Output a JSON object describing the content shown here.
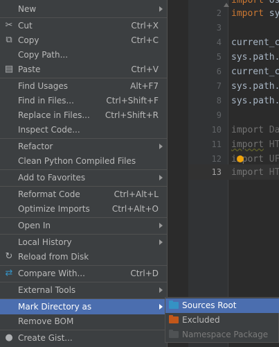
{
  "editor": {
    "line_numbers": [
      "2",
      "3",
      "4",
      "5",
      "6",
      "7",
      "8",
      "9",
      "10",
      "11",
      "12",
      "13"
    ],
    "current_line": "13",
    "lines": [
      {
        "kw": "import",
        "rest": " sy"
      },
      {
        "kw": "",
        "rest": ""
      },
      {
        "kw": "",
        "rest": "current_c"
      },
      {
        "kw": "",
        "rest": "sys.path."
      },
      {
        "kw": "",
        "rest": "current_c"
      },
      {
        "kw": "",
        "rest": "sys.path."
      },
      {
        "kw": "",
        "rest": "sys.path."
      },
      {
        "kw": "",
        "rest": ""
      },
      {
        "kw": "import",
        "rest": " Da"
      },
      {
        "kw": "import",
        "rest": " HT"
      },
      {
        "kw": "import",
        "rest": " UF"
      },
      {
        "kw": "import",
        "rest": " HT"
      }
    ],
    "top_partial": {
      "kw": "import",
      "rest": " os"
    }
  },
  "menu": {
    "items": [
      {
        "label": "New",
        "icon": "",
        "shortcut": "",
        "submenu": true
      },
      {
        "label": "Cut",
        "icon": "✂",
        "shortcut": "Ctrl+X",
        "submenu": false
      },
      {
        "label": "Copy",
        "icon": "⧉",
        "shortcut": "Ctrl+C",
        "submenu": false
      },
      {
        "label": "Copy Path...",
        "icon": "",
        "shortcut": "",
        "submenu": false
      },
      {
        "label": "Paste",
        "icon": "▤",
        "shortcut": "Ctrl+V",
        "submenu": false
      },
      {
        "label": "Find Usages",
        "icon": "",
        "shortcut": "Alt+F7",
        "submenu": false
      },
      {
        "label": "Find in Files...",
        "icon": "",
        "shortcut": "Ctrl+Shift+F",
        "submenu": false
      },
      {
        "label": "Replace in Files...",
        "icon": "",
        "shortcut": "Ctrl+Shift+R",
        "submenu": false
      },
      {
        "label": "Inspect Code...",
        "icon": "",
        "shortcut": "",
        "submenu": false
      },
      {
        "label": "Refactor",
        "icon": "",
        "shortcut": "",
        "submenu": true
      },
      {
        "label": "Clean Python Compiled Files",
        "icon": "",
        "shortcut": "",
        "submenu": false
      },
      {
        "label": "Add to Favorites",
        "icon": "",
        "shortcut": "",
        "submenu": true
      },
      {
        "label": "Reformat Code",
        "icon": "",
        "shortcut": "Ctrl+Alt+L",
        "submenu": false
      },
      {
        "label": "Optimize Imports",
        "icon": "",
        "shortcut": "Ctrl+Alt+O",
        "submenu": false
      },
      {
        "label": "Open In",
        "icon": "",
        "shortcut": "",
        "submenu": true
      },
      {
        "label": "Local History",
        "icon": "",
        "shortcut": "",
        "submenu": true
      },
      {
        "label": "Reload from Disk",
        "icon": "↻",
        "shortcut": "",
        "submenu": false
      },
      {
        "label": "Compare With...",
        "icon": "⇄",
        "shortcut": "Ctrl+D",
        "submenu": false
      },
      {
        "label": "External Tools",
        "icon": "",
        "shortcut": "",
        "submenu": true
      },
      {
        "label": "Mark Directory as",
        "icon": "",
        "shortcut": "",
        "submenu": true
      },
      {
        "label": "Remove BOM",
        "icon": "",
        "shortcut": "",
        "submenu": false
      },
      {
        "label": "Create Gist...",
        "icon": "●",
        "shortcut": "",
        "submenu": false
      }
    ],
    "selected_label": "Mark Directory as"
  },
  "submenu": {
    "items": [
      {
        "label": "Sources Root",
        "color": "#3592c4"
      },
      {
        "label": "Excluded",
        "color": "#c2571a"
      },
      {
        "label": "Namespace Package",
        "color": "#4f5254"
      }
    ]
  },
  "colors": {
    "accent": "#4b6eaf",
    "menu_bg": "#3c3f41",
    "editor_bg": "#2b2b2b",
    "keyword": "#cc7832"
  }
}
